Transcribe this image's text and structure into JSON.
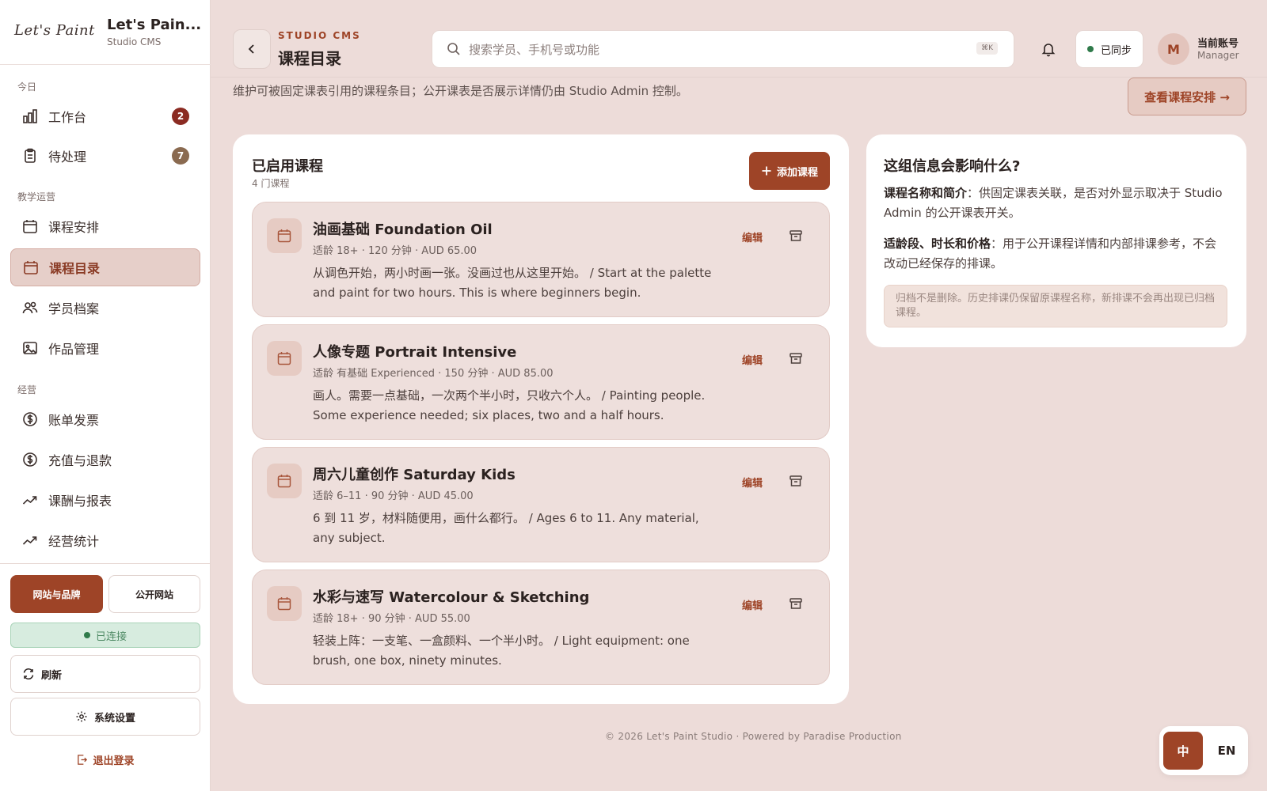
{
  "brand": {
    "logo_text": "Let's Paint",
    "name": "Let's Pain...",
    "sub": "Studio CMS"
  },
  "sidebar": {
    "sections": [
      "今日",
      "教学运营",
      "经营"
    ],
    "items": [
      {
        "label": "工作台",
        "badge": "2",
        "icon": "bar-chart-icon"
      },
      {
        "label": "待处理",
        "badge": "7",
        "icon": "clipboard-icon"
      },
      {
        "label": "课程安排",
        "icon": "calendar-icon"
      },
      {
        "label": "课程目录",
        "icon": "calendar-icon",
        "active": true
      },
      {
        "label": "学员档案",
        "icon": "users-icon"
      },
      {
        "label": "作品管理",
        "icon": "image-icon"
      },
      {
        "label": "账单发票",
        "icon": "dollar-icon"
      },
      {
        "label": "充值与退款",
        "icon": "dollar-icon"
      },
      {
        "label": "课酬与报表",
        "icon": "trend-icon"
      },
      {
        "label": "经营统计",
        "icon": "trend-icon"
      }
    ],
    "btn_brand": "网站与品牌",
    "btn_public": "公开网站",
    "connected": "已连接",
    "refresh": "刷新",
    "settings": "系统设置",
    "logout": "退出登录"
  },
  "header": {
    "kicker": "STUDIO CMS",
    "title": "课程目录",
    "search_placeholder": "搜索学员、手机号或功能",
    "search_shortcut": "⌘K",
    "sync": "已同步",
    "avatar_initial": "M",
    "account_name": "当前账号",
    "account_role": "Manager"
  },
  "description": "维护可被固定课表引用的课程条目；公开课表是否展示详情仍由 Studio Admin 控制。",
  "schedule_button": "查看课程安排 →",
  "courses_card": {
    "title": "已启用课程",
    "count": "4 门课程",
    "add_button": "添加课程",
    "edit_label": "编辑",
    "courses": [
      {
        "title": "油画基础 Foundation Oil",
        "meta": "适龄 18+ · 120 分钟 · AUD 65.00",
        "desc": "从调色开始，两小时画一张。没画过也从这里开始。 / Start at the palette and paint for two hours. This is where beginners begin."
      },
      {
        "title": "人像专题 Portrait Intensive",
        "meta": "适龄 有基础 Experienced · 150 分钟 · AUD 85.00",
        "desc": "画人。需要一点基础，一次两个半小时，只收六个人。 / Painting people. Some experience needed; six places, two and a half hours."
      },
      {
        "title": "周六儿童创作 Saturday Kids",
        "meta": "适龄 6–11 · 90 分钟 · AUD 45.00",
        "desc": "6 到 11 岁，材料随便用，画什么都行。 / Ages 6 to 11. Any material, any subject."
      },
      {
        "title": "水彩与速写 Watercolour & Sketching",
        "meta": "适龄 18+ · 90 分钟 · AUD 55.00",
        "desc": "轻装上阵：一支笔、一盒颜料、一个半小时。 / Light equipment: one brush, one box, ninety minutes."
      }
    ]
  },
  "info_card": {
    "title": "这组信息会影响什么?",
    "p1_label": "课程名称和简介",
    "p1_text": "：供固定课表关联，是否对外显示取决于 Studio Admin 的公开课表开关。",
    "p2_label": "适龄段、时长和价格",
    "p2_text": "：用于公开课程详情和内部排课参考，不会改动已经保存的排课。",
    "note": "归档不是删除。历史排课仍保留原课程名称，新排课不会再出现已归档课程。"
  },
  "footer": "© 2026 Let's Paint Studio · Powered by Paradise Production",
  "language": {
    "zh": "中",
    "en": "EN"
  },
  "colors": {
    "accent": "#9e4427",
    "background": "#eddcd9",
    "badge_red": "#8b2b22",
    "badge_brown": "#8a6a50",
    "status_green": "#2f7a4a"
  }
}
